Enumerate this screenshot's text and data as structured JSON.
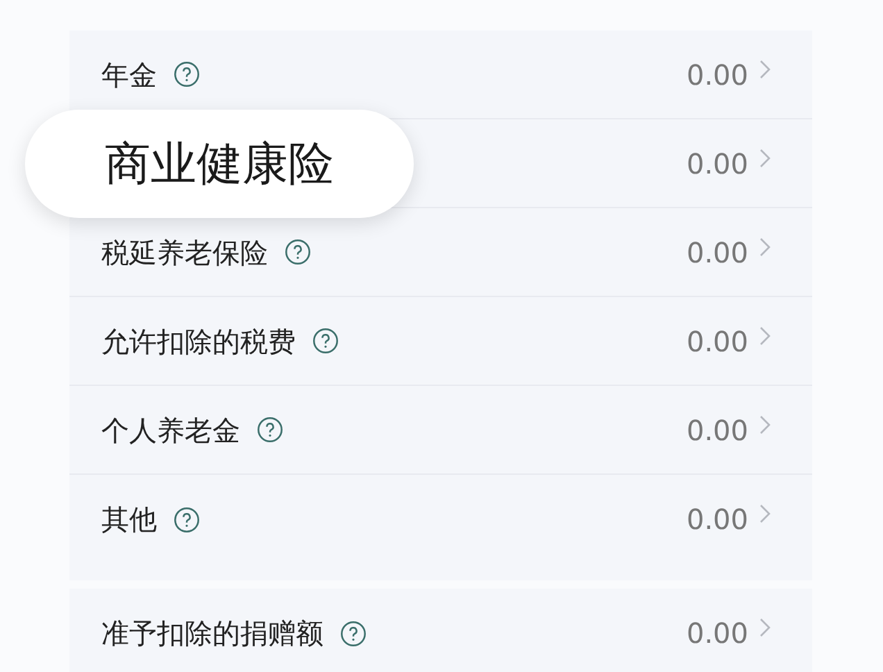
{
  "sections": [
    {
      "rows": [
        {
          "label": "年金",
          "value": "0.00"
        },
        {
          "value": "0.00"
        },
        {
          "label": "税延养老保险",
          "value": "0.00"
        },
        {
          "label": "允许扣除的税费",
          "value": "0.00"
        },
        {
          "label": "个人养老金",
          "value": "0.00"
        },
        {
          "label": "其他",
          "value": "0.00"
        }
      ]
    },
    {
      "rows": [
        {
          "label": "准予扣除的捐赠额",
          "value": "0.00"
        }
      ]
    }
  ],
  "callout": {
    "text": "商业健康险"
  }
}
